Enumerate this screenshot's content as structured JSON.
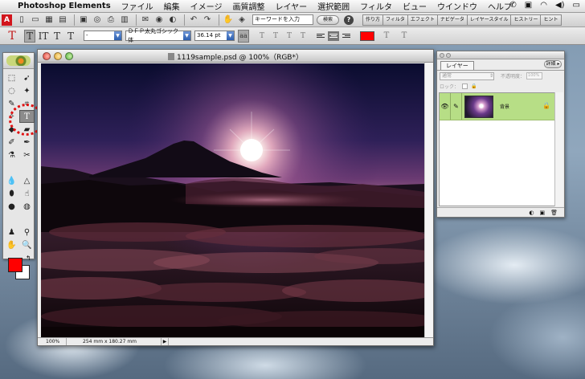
{
  "menubar": {
    "apple_symbol": "",
    "app_name": "Photoshop Elements",
    "items": [
      "ファイル",
      "編集",
      "イメージ",
      "画質調整",
      "レイヤー",
      "選択範囲",
      "フィルタ",
      "ビュー",
      "ウインドウ",
      "ヘルプ"
    ]
  },
  "shortcuts": {
    "adobe_logo": "A",
    "search_text": "キーワードを入力",
    "search_button": "検索",
    "help": "?",
    "palette_well_tabs": [
      "作り方",
      "フィルタ",
      "エフェクト",
      "ナビゲータ",
      "レイヤースタイル",
      "ヒストリー",
      "ヒント"
    ]
  },
  "options_bar": {
    "tool_glyph": "T",
    "horizontal_type": "T",
    "vertical_type": "IT",
    "mask_type": "T",
    "vertical_mask_type": "T",
    "font_style": "-",
    "font_family": "ＤＦＰ太丸ゴシック体",
    "font_size": "36.14 pt",
    "aa_label": "aa",
    "text_color": "#ff0000",
    "warp_icon": "T",
    "orientation_icon": "T"
  },
  "toolbox": {
    "colors": {
      "foreground": "#ff0000",
      "background": "#ffffff"
    }
  },
  "document": {
    "title": "1119sample.psd @ 100%（RGB*）",
    "status_zoom": "100%",
    "status_size": "254 mm x 180.27 mm",
    "status_arrow": "▶"
  },
  "layers_palette": {
    "tab_label": "レイヤー",
    "more_button": "詳細 ▸",
    "blend_mode": "通常",
    "opacity_label": "不透明度：",
    "opacity_value": "100%",
    "lock_label": "ロック：",
    "layers": [
      {
        "name": "背景",
        "visible": true
      }
    ]
  }
}
